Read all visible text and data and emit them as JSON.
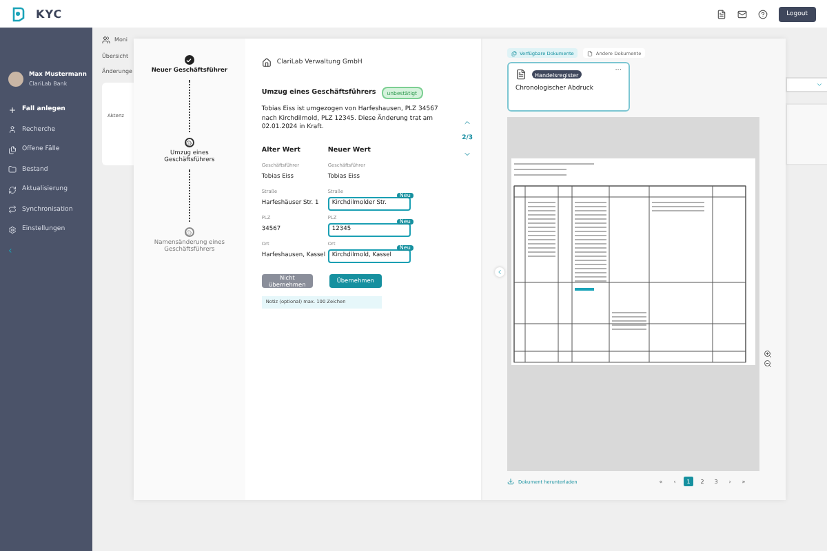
{
  "topbar": {
    "logo": "KYC",
    "logout": "Logout"
  },
  "sidebar": {
    "user": {
      "name": "Max Mustermann",
      "org": "ClariLab Bank"
    },
    "items": [
      {
        "label": "Fall anlegen",
        "selected": true
      },
      {
        "label": "Recherche",
        "selected": false
      },
      {
        "label": "Offene Fälle",
        "selected": false
      },
      {
        "label": "Bestand",
        "selected": false
      },
      {
        "label": "Aktualisierung",
        "selected": false
      },
      {
        "label": "Synchronisation",
        "selected": false
      },
      {
        "label": "Einstellungen",
        "selected": false
      }
    ],
    "collapse": "‹"
  },
  "background_page": {
    "title": "Moni",
    "tab": "Übersicht",
    "section": "Änderunge",
    "column": "Aktenz"
  },
  "steps": [
    {
      "label": "Neuer Geschäftsführer",
      "kind": "done"
    },
    {
      "label": "Umzug eines Geschäftsführers",
      "kind": "current"
    },
    {
      "label": "Namensänderung eines Geschäftsführers",
      "kind": "pending"
    }
  ],
  "change": {
    "company": "ClariLab Verwaltung GmbH",
    "title": "Umzug eines Geschäftsführers",
    "badge": "unbestätigt",
    "description": "Tobias Eiss ist umgezogen von Harfeshausen, PLZ 34567 nach Kirchdilmold, PLZ 12345. Diese Änderung trat am 02.01.2024 in Kraft.",
    "counter": "2/3",
    "old_header": "Alter Wert",
    "new_header": "Neuer Wert",
    "fields": [
      {
        "old_label": "Geschäftsführer",
        "new_label": "Geschäftsführer",
        "old": "Tobias Eiss",
        "new": "Tobias Eiss",
        "kind": "text"
      },
      {
        "old_label": "Straße",
        "new_label": "Straße",
        "old": "Harfeshäuser Str. 1",
        "new": "Kirchdilmolder Str.",
        "kind": "input",
        "badge": "Neu"
      },
      {
        "old_label": "PLZ",
        "new_label": "PLZ",
        "old": "34567",
        "new": "12345",
        "kind": "input",
        "badge": "Neu"
      },
      {
        "old_label": "Ort",
        "new_label": "Ort",
        "old": "Harfeshausen, Kassel",
        "new": "Kirchdilmold, Kassel",
        "kind": "input",
        "badge": "Neu"
      }
    ],
    "reject": "Nicht übernehmen",
    "accept": "Übernehmen",
    "note": {
      "placeholder": "Notiz (optional) max. 100 Zeichen"
    }
  },
  "documents": {
    "tabs": [
      {
        "label": "Verfügbare Dokumente",
        "selected": true
      },
      {
        "label": "Andere Dokumente",
        "selected": false
      }
    ],
    "card": {
      "badge": "Handelsregister",
      "title": "Chronologischer Abdruck",
      "menu": "···"
    },
    "download": "Dokument herunterladen",
    "pages": [
      {
        "label": "«",
        "kind": "nav"
      },
      {
        "label": "‹",
        "kind": "nav"
      },
      {
        "label": "1",
        "selected": true,
        "kind": "page"
      },
      {
        "label": "2",
        "selected": false,
        "kind": "page"
      },
      {
        "label": "3",
        "selected": false,
        "kind": "page"
      },
      {
        "label": "›",
        "kind": "nav"
      },
      {
        "label": "»",
        "kind": "nav"
      }
    ]
  }
}
